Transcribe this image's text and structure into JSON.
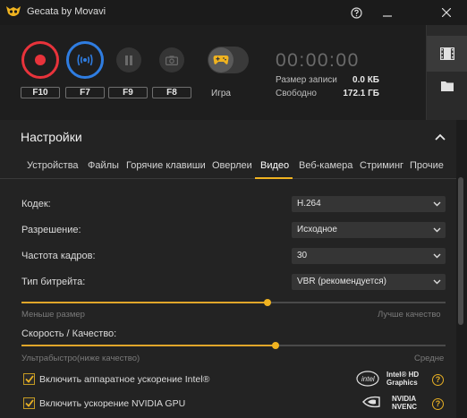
{
  "window": {
    "title": "Gecata by Movavi",
    "help_icon": "question-circle-icon",
    "minimize_icon": "minimize-icon",
    "close_icon": "close-icon"
  },
  "controls": {
    "hotkeys": [
      "F10",
      "F7",
      "F9",
      "F8"
    ],
    "game_mode_label": "Игра",
    "game_mode_on": false,
    "timer": "00:00:00",
    "record_size_label": "Размер записи",
    "record_size_value": "0.0 КБ",
    "free_space_label": "Свободно",
    "free_space_value": "172.1 ГБ"
  },
  "side_panel": {
    "items": [
      "film-strip-icon",
      "folder-icon"
    ]
  },
  "settings": {
    "title": "Настройки",
    "tabs": [
      "Устройства",
      "Файлы",
      "Горячие клавиши",
      "Оверлеи",
      "Видео",
      "Веб-камера",
      "Стриминг",
      "Прочие"
    ],
    "active_tab": "Видео",
    "fields": {
      "codec_label": "Кодек:",
      "codec_value": "H.264",
      "resolution_label": "Разрешение:",
      "resolution_value": "Исходное",
      "framerate_label": "Частота кадров:",
      "framerate_value": "30",
      "bitrate_label": "Тип битрейта:",
      "bitrate_value": "VBR (рекомендуется)"
    },
    "quality_slider": {
      "min_label": "Меньше размер",
      "max_label": "Лучше качество",
      "value_fraction": 0.58
    },
    "speed_slider": {
      "label": "Скорость / Качество:",
      "min_label": "Ультрабыстро(ниже качество)",
      "max_label": "Средне",
      "value_fraction": 0.6
    },
    "hw_accel": {
      "intel_label": "Включить аппаратное ускорение Intel®",
      "intel_checked": true,
      "intel_logo_text": "Intel® HD Graphics",
      "nvidia_label": "Включить ускорение NVIDIA GPU",
      "nvidia_checked": true,
      "nvidia_logo_text": "NVIDIA NVENC"
    }
  },
  "colors": {
    "record_red": "#e8333b",
    "stream_blue": "#2f7de1",
    "accent_yellow": "#f0b320"
  }
}
